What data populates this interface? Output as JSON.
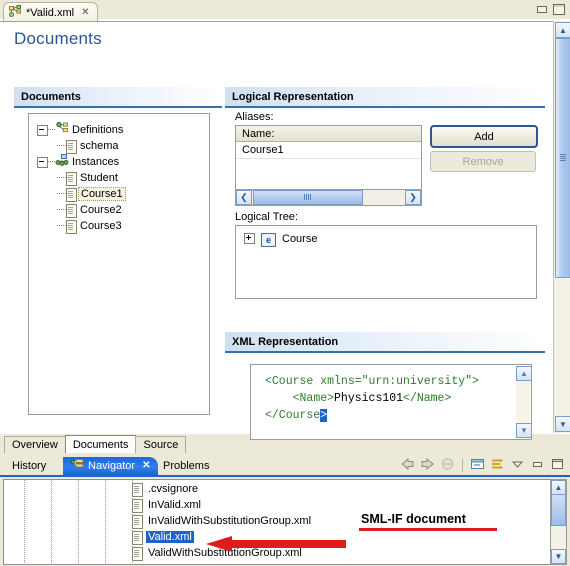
{
  "window": {
    "minimize_label": "Minimize",
    "maximize_label": "Maximize"
  },
  "editor": {
    "tab": {
      "title": "*Valid.xml",
      "icon": "graph-icon",
      "close": "✕"
    },
    "form_title": "Documents",
    "documents_section": {
      "header": "Documents",
      "tree": [
        {
          "label": "Definitions",
          "icon": "definitions-icon",
          "depth": 0,
          "twisty": "minus",
          "selected": false
        },
        {
          "label": "schema",
          "icon": "document-icon",
          "depth": 1,
          "twisty": "none",
          "selected": false
        },
        {
          "label": "Instances",
          "icon": "instances-icon",
          "depth": 0,
          "twisty": "minus",
          "selected": false
        },
        {
          "label": "Student",
          "icon": "document-icon",
          "depth": 1,
          "twisty": "none",
          "selected": false
        },
        {
          "label": "Course1",
          "icon": "document-icon",
          "depth": 1,
          "twisty": "none",
          "selected": true
        },
        {
          "label": "Course2",
          "icon": "document-icon",
          "depth": 1,
          "twisty": "none",
          "selected": false
        },
        {
          "label": "Course3",
          "icon": "document-icon",
          "depth": 1,
          "twisty": "none",
          "selected": false
        }
      ]
    },
    "logical_section": {
      "header": "Logical Representation",
      "aliases_label": "Aliases:",
      "aliases_column": "Name:",
      "aliases_rows": [
        "Course1"
      ],
      "add_label": "Add",
      "remove_label": "Remove",
      "logical_tree_label": "Logical Tree:",
      "logical_tree_items": [
        {
          "label": "Course",
          "icon": "element-icon",
          "twisty": "plus"
        }
      ]
    },
    "xml_section": {
      "header": "XML Representation",
      "lines": [
        {
          "indent": 0,
          "parts": [
            {
              "t": "<Course xmlns=\"urn:university\">",
              "c": "tag"
            }
          ]
        },
        {
          "indent": 1,
          "parts": [
            {
              "t": "<Name>",
              "c": "tag"
            },
            {
              "t": "Physics101",
              "c": "text"
            },
            {
              "t": "</Name>",
              "c": "tag"
            }
          ]
        },
        {
          "indent": 0,
          "parts": [
            {
              "t": "</Course",
              "c": "tag"
            },
            {
              "t": ">",
              "c": "caret"
            }
          ]
        }
      ]
    },
    "page_tabs": [
      {
        "label": "Overview",
        "active": false
      },
      {
        "label": "Documents",
        "active": true
      },
      {
        "label": "Source",
        "active": false
      }
    ]
  },
  "bottom_view": {
    "tabs": [
      {
        "label": "History",
        "active": false,
        "icon": "none",
        "closable": false
      },
      {
        "label": "Navigator",
        "active": true,
        "icon": "navigator-icon",
        "closable": true,
        "close": "✕"
      },
      {
        "label": "Problems",
        "active": false,
        "icon": "none",
        "closable": false
      }
    ],
    "toolbar": [
      {
        "name": "back-icon",
        "enabled": true
      },
      {
        "name": "forward-icon",
        "enabled": true
      },
      {
        "name": "home-icon",
        "enabled": false
      },
      {
        "name": "collapse-all-icon",
        "enabled": true
      },
      {
        "name": "link-with-editor-icon",
        "enabled": true
      },
      {
        "name": "view-menu-icon",
        "enabled": true
      },
      {
        "name": "minimize-icon",
        "enabled": true
      },
      {
        "name": "maximize-icon",
        "enabled": true
      }
    ],
    "files": [
      {
        "label": ".cvsignore",
        "selected": false
      },
      {
        "label": "InValid.xml",
        "selected": false
      },
      {
        "label": "InValidWithSubstitutionGroup.xml",
        "selected": false
      },
      {
        "label": "Valid.xml",
        "selected": true
      },
      {
        "label": "ValidWithSubstitutionGroup.xml",
        "selected": false
      }
    ]
  },
  "annotation": {
    "text": "SML-IF document",
    "color": "#e01b1b"
  }
}
